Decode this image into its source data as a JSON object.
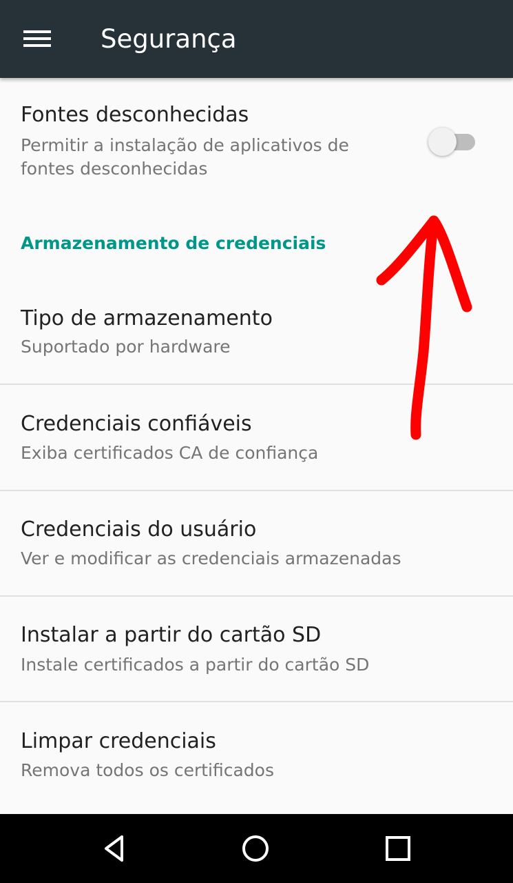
{
  "toolbar": {
    "title": "Segurança",
    "menu_icon": "hamburger-menu-icon"
  },
  "unknown_sources": {
    "title": "Fontes desconhecidas",
    "summary": "Permitir a instalação de aplicativos de fontes desconhecidas",
    "enabled": false
  },
  "credential_storage": {
    "category": "Armazenamento de credenciais",
    "items": [
      {
        "title": "Tipo de armazenamento",
        "summary": "Suportado por hardware"
      },
      {
        "title": "Credenciais confiáveis",
        "summary": "Exiba certificados CA de confiança"
      },
      {
        "title": "Credenciais do usuário",
        "summary": "Ver e modificar as credenciais armazenadas"
      },
      {
        "title": "Instalar a partir do cartão SD",
        "summary": "Instale certificados a partir do cartão SD"
      },
      {
        "title": "Limpar credenciais",
        "summary": "Remova todos os certificados"
      }
    ]
  },
  "navbar": {
    "back_icon": "back-triangle-icon",
    "home_icon": "home-circle-icon",
    "recents_icon": "recents-square-icon"
  },
  "colors": {
    "toolbar": "#263238",
    "accent": "#009688",
    "annotation": "#ff0000",
    "background": "#fafafa"
  }
}
